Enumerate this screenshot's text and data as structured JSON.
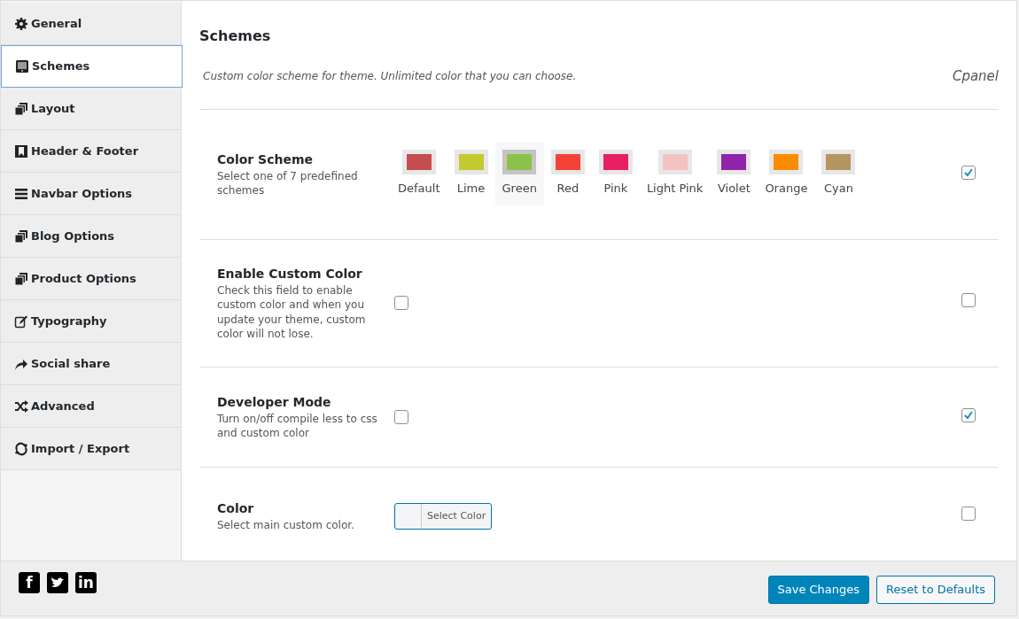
{
  "sidebar": {
    "items": [
      {
        "label": "General",
        "kind": "gear",
        "selected": false
      },
      {
        "label": "Schemes",
        "kind": "monitor",
        "selected": true
      },
      {
        "label": "Layout",
        "kind": "stack",
        "selected": false
      },
      {
        "label": "Header & Footer",
        "kind": "bookmark",
        "selected": false
      },
      {
        "label": "Navbar Options",
        "kind": "bars",
        "selected": false
      },
      {
        "label": "Blog Options",
        "kind": "stack",
        "selected": false
      },
      {
        "label": "Product Options",
        "kind": "stack",
        "selected": false
      },
      {
        "label": "Typography",
        "kind": "edit",
        "selected": false
      },
      {
        "label": "Social share",
        "kind": "share",
        "selected": false
      },
      {
        "label": "Advanced",
        "kind": "shuffle",
        "selected": false
      },
      {
        "label": "Import / Export",
        "kind": "refresh",
        "selected": false
      }
    ]
  },
  "section": {
    "title": "Schemes",
    "description": "Custom color scheme for theme. Unlimited color that you can choose.",
    "brand": "Cpanel"
  },
  "options": [
    {
      "kind": "swatches",
      "title": "Color Scheme",
      "description": "Select one of 7 predefined schemes",
      "checked": true,
      "swatches": [
        {
          "label": "Default",
          "color": "#c44d4f",
          "selected": false
        },
        {
          "label": "Lime",
          "color": "#c2ca30",
          "selected": false
        },
        {
          "label": "Green",
          "color": "#8bc34a",
          "selected": true
        },
        {
          "label": "Red",
          "color": "#f44336",
          "selected": false
        },
        {
          "label": "Pink",
          "color": "#e91e63",
          "selected": false
        },
        {
          "label": "Light Pink",
          "color": "#f4c2c2",
          "selected": false
        },
        {
          "label": "Violet",
          "color": "#8e24aa",
          "selected": false
        },
        {
          "label": "Orange",
          "color": "#fb8c00",
          "selected": false
        },
        {
          "label": "Cyan",
          "color": "#b59560",
          "selected": false
        }
      ]
    },
    {
      "kind": "checkbox",
      "title": "Enable Custom Color",
      "description": "Check this field to enable custom color and when you update your theme, custom color will not lose.",
      "checked": false,
      "value": false
    },
    {
      "kind": "checkbox",
      "title": "Developer Mode",
      "description": "Turn on/off compile less to css and custom color",
      "checked": true,
      "value": false
    },
    {
      "kind": "colorpicker",
      "title": "Color",
      "description": "Select main custom color.",
      "checked": false,
      "button": "Select Color"
    }
  ],
  "social": [
    {
      "kind": "facebook",
      "glyph": "f"
    },
    {
      "kind": "twitter"
    },
    {
      "kind": "linkedin",
      "glyph": "in"
    }
  ],
  "footer": {
    "save": "Save Changes",
    "reset": "Reset to Defaults"
  }
}
